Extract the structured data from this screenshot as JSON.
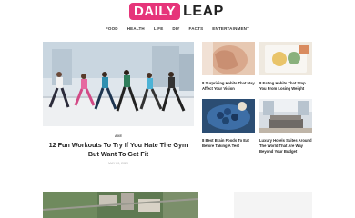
{
  "brand": {
    "logo_boxed": "DAILY",
    "logo_rest": "LEAP",
    "accent": "#e6357a"
  },
  "nav": [
    "FOOD",
    "HEALTH",
    "LIFE",
    "DIY",
    "FACTS",
    "ENTERTAINMENT"
  ],
  "featured": {
    "tag": "AXE",
    "title": "12 Fun Workouts To Try If You Hate The Gym But Want To Get Fit",
    "date": "MAY 20, 2020"
  },
  "side_articles": [
    {
      "title": "8 Surprising Habits That May Affect Your Vision"
    },
    {
      "title": "8 Eating Habits That Stop You From Losing Weight"
    },
    {
      "title": "8 Best Brain Foods To Eat Before Taking A Test"
    },
    {
      "title": "Luxury Hotels Suites Around The World That Are Way Beyond Your Budget"
    }
  ]
}
